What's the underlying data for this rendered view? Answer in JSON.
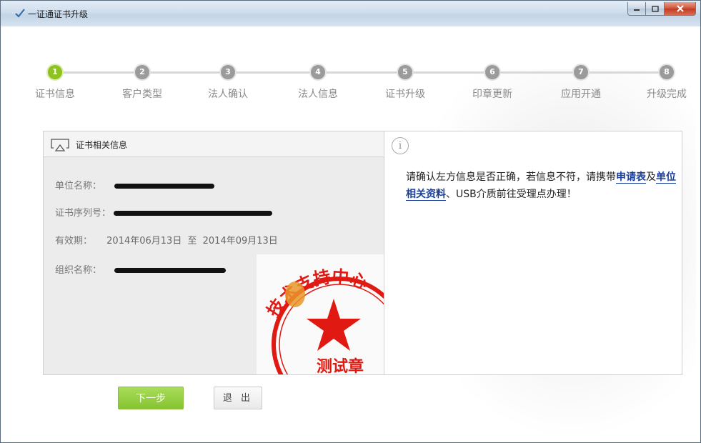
{
  "window": {
    "title": "一证通证书升级",
    "app_icon": "checkmark-icon",
    "controls": {
      "minimize": "minimize-icon",
      "maximize": "maximize-icon",
      "close": "close-icon"
    }
  },
  "steps": [
    {
      "num": "1",
      "label": "证书信息",
      "active": true
    },
    {
      "num": "2",
      "label": "客户类型",
      "active": false
    },
    {
      "num": "3",
      "label": "法人确认",
      "active": false
    },
    {
      "num": "4",
      "label": "法人信息",
      "active": false
    },
    {
      "num": "5",
      "label": "证书升级",
      "active": false
    },
    {
      "num": "6",
      "label": "印章更新",
      "active": false
    },
    {
      "num": "7",
      "label": "应用开通",
      "active": false
    },
    {
      "num": "8",
      "label": "升级完成",
      "active": false
    }
  ],
  "cert_panel": {
    "title": "证书相关信息",
    "icon": "certificate-screen-icon",
    "fields": {
      "unit_name": {
        "label": "单位名称："
      },
      "serial": {
        "label": "证书序列号："
      },
      "validity": {
        "label": "有效期：",
        "from": "2014年06月13日",
        "to_word": "至",
        "to": "2014年09月13日"
      },
      "org_name": {
        "label": "组织名称："
      }
    },
    "seal": {
      "text": "技术支持中心",
      "bottom_text": "测试章",
      "color": "#e01a12"
    }
  },
  "info_panel": {
    "icon": "info-icon",
    "message_part1": "请确认左方信息是否正确，若信息不符，请携带",
    "link1": "申请表",
    "message_part2": "及",
    "link2": "单位相关资料",
    "message_part3": "、USB介质前往受理点办理！"
  },
  "buttons": {
    "next": "下一步",
    "exit": "退 出"
  },
  "colors": {
    "active_step": "#8ec21f",
    "inactive_step": "#9b9b9b",
    "link": "#1a3f9a",
    "seal_red": "#e01a12"
  }
}
